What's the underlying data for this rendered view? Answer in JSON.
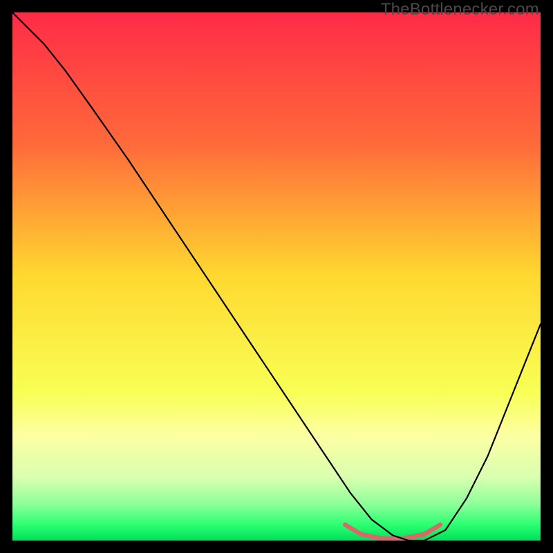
{
  "watermark": "TheBottlenecker.com",
  "chart_data": {
    "type": "line",
    "title": "",
    "xlabel": "",
    "ylabel": "",
    "xlim": [
      0,
      100
    ],
    "ylim": [
      0,
      100
    ],
    "gradient_stops": [
      {
        "offset": 0,
        "color": "#ff2b47"
      },
      {
        "offset": 0.25,
        "color": "#ff6a3a"
      },
      {
        "offset": 0.5,
        "color": "#ffd930"
      },
      {
        "offset": 0.72,
        "color": "#f8ff55"
      },
      {
        "offset": 0.8,
        "color": "#fdffa2"
      },
      {
        "offset": 0.88,
        "color": "#d9ffb0"
      },
      {
        "offset": 0.93,
        "color": "#8fff9a"
      },
      {
        "offset": 0.97,
        "color": "#2bff72"
      },
      {
        "offset": 1.0,
        "color": "#00e05a"
      }
    ],
    "series": [
      {
        "name": "bottleneck-curve",
        "color": "#000000",
        "width": 2.2,
        "x": [
          0,
          3,
          6,
          10,
          15,
          22,
          30,
          38,
          46,
          54,
          60,
          64,
          68,
          72,
          75,
          78,
          82,
          86,
          90,
          94,
          98,
          100
        ],
        "y": [
          100,
          97,
          94,
          89,
          82,
          72,
          60,
          48,
          36,
          24,
          15,
          9,
          4,
          1,
          0,
          0,
          2,
          8,
          16,
          26,
          36,
          41
        ]
      }
    ],
    "trough_band": {
      "name": "optimal-zone",
      "color": "#d46a6a",
      "width": 6.5,
      "x": [
        63,
        66,
        70,
        74,
        78,
        81
      ],
      "y": [
        3,
        1.2,
        0.4,
        0.4,
        1.2,
        3
      ]
    }
  }
}
